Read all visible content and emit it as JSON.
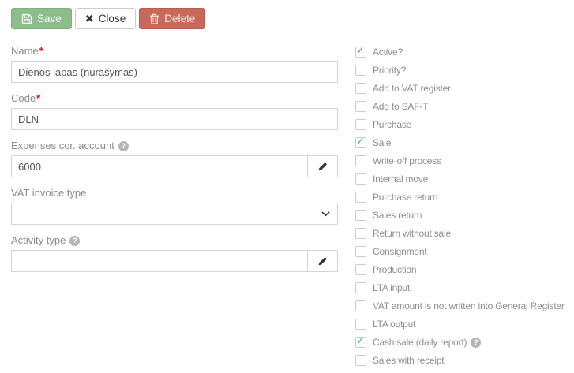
{
  "toolbar": {
    "save_label": "Save",
    "close_label": "Close",
    "delete_label": "Delete"
  },
  "fields": {
    "name": {
      "label": "Name",
      "required": "*",
      "value": "Dienos lapas (nurašymas)"
    },
    "code": {
      "label": "Code",
      "required": "*",
      "value": "DLN"
    },
    "expenses_cor_account": {
      "label": "Expenses cor. account",
      "value": "6000"
    },
    "vat_invoice_type": {
      "label": "VAT invoice type",
      "value": ""
    },
    "activity_type": {
      "label": "Activity type",
      "value": ""
    }
  },
  "checkboxes": [
    {
      "label": "Active?",
      "checked": true
    },
    {
      "label": "Priority?",
      "checked": false
    },
    {
      "label": "Add to VAT register",
      "checked": false
    },
    {
      "label": "Add to SAF-T",
      "checked": false
    },
    {
      "label": "Purchase",
      "checked": false
    },
    {
      "label": "Sale",
      "checked": true
    },
    {
      "label": "Write-off process",
      "checked": false
    },
    {
      "label": "Internal move",
      "checked": false
    },
    {
      "label": "Purchase return",
      "checked": false
    },
    {
      "label": "Sales return",
      "checked": false
    },
    {
      "label": "Return without sale",
      "checked": false
    },
    {
      "label": "Consignment",
      "checked": false
    },
    {
      "label": "Production",
      "checked": false
    },
    {
      "label": "LTA input",
      "checked": false
    },
    {
      "label": "VAT amount is not written into General Register",
      "checked": false
    },
    {
      "label": "LTA output",
      "checked": false
    },
    {
      "label": "Cash sale (daily report)",
      "checked": true
    },
    {
      "label": "Sales with receipt",
      "checked": false
    }
  ],
  "icons": {
    "save_icon": "floppy-disk",
    "close_icon": "✖",
    "delete_icon": "trash-can",
    "edit_icon": "pencil",
    "help_icon": "?",
    "select_chevron": "chevron-down",
    "check_glyph": "✓"
  },
  "colors": {
    "save_green": "#8cbe8c",
    "delete_red": "#c9695b",
    "check_blue": "#3d9bd5",
    "label_gray": "#8a8a8a",
    "required_red": "#e00000",
    "input_border": "#d5d5d5"
  }
}
